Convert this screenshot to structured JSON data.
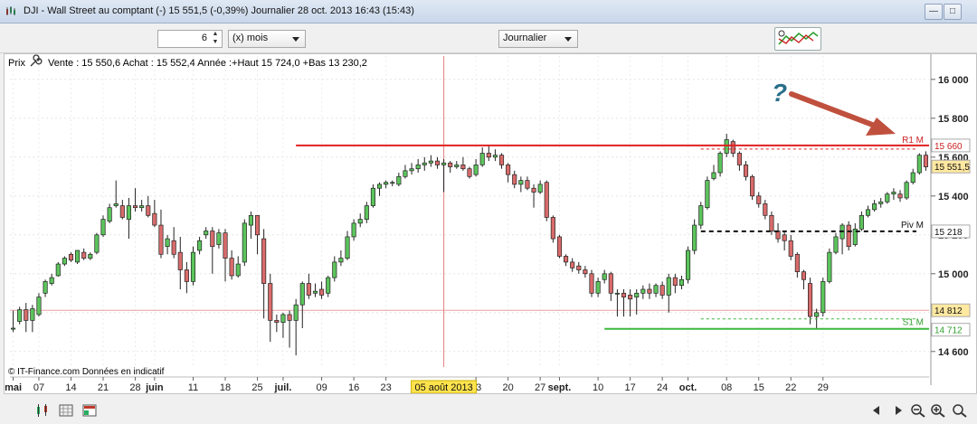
{
  "window": {
    "title": "DJI - Wall Street au comptant (-)   15 551,5 (-0,39%)   Journalier  28 oct. 2013 16:43 (15:43)"
  },
  "toolbar": {
    "period_value": "6",
    "period_unit": "(x) mois",
    "timeframe": "Journalier"
  },
  "chart_header": {
    "price_label": "Prix",
    "quote_text": "Vente : 15 550,6 Achat : 15 552,4 Année :+Haut 15 724,0 +Bas 13 230,2"
  },
  "annotation": {
    "question_mark": "?"
  },
  "levels": [
    {
      "name": "R1 M",
      "value": 15660,
      "value_label": "15 660",
      "color": "#cc1f1f"
    },
    {
      "name": "Piv M",
      "value": 15218,
      "value_label": "15 218",
      "color": "#111111"
    },
    {
      "name": "S1 M",
      "value": 14712,
      "value_label": "14 712",
      "color": "#2e9e2e"
    }
  ],
  "price_badges": {
    "current": "15 551,5",
    "hline": "14 812"
  },
  "footer": {
    "copyright": "© IT-Finance.com  Données en indicatif",
    "cursor_date": "05 août 2013"
  },
  "chart_data": {
    "type": "candlestick",
    "title": "DJI - Wall Street au comptant (-)",
    "ylim": [
      14520,
      16120
    ],
    "y_ticks": [
      14600,
      14800,
      15000,
      15200,
      15400,
      15600,
      15800,
      16000
    ],
    "y_tick_labels": [
      "14 600",
      "14 800",
      "15 000",
      "15 200",
      "15 400",
      "15 600",
      "15 800",
      "16 000"
    ],
    "x_labels": [
      {
        "i": 0,
        "text": "mai",
        "bold": true
      },
      {
        "i": 4,
        "text": "07",
        "bold": false
      },
      {
        "i": 9,
        "text": "14",
        "bold": false
      },
      {
        "i": 14,
        "text": "21",
        "bold": false
      },
      {
        "i": 19,
        "text": "28",
        "bold": false
      },
      {
        "i": 22,
        "text": "juin",
        "bold": true
      },
      {
        "i": 28,
        "text": "11",
        "bold": false
      },
      {
        "i": 33,
        "text": "18",
        "bold": false
      },
      {
        "i": 38,
        "text": "25",
        "bold": false
      },
      {
        "i": 42,
        "text": "juil.",
        "bold": true
      },
      {
        "i": 48,
        "text": "09",
        "bold": false
      },
      {
        "i": 53,
        "text": "16",
        "bold": false
      },
      {
        "i": 58,
        "text": "23",
        "bold": false
      },
      {
        "i": 72,
        "text": "13",
        "bold": false
      },
      {
        "i": 77,
        "text": "20",
        "bold": false
      },
      {
        "i": 82,
        "text": "27",
        "bold": false
      },
      {
        "i": 85,
        "text": "sept.",
        "bold": true
      },
      {
        "i": 91,
        "text": "10",
        "bold": false
      },
      {
        "i": 96,
        "text": "17",
        "bold": false
      },
      {
        "i": 101,
        "text": "24",
        "bold": false
      },
      {
        "i": 105,
        "text": "oct.",
        "bold": true
      },
      {
        "i": 111,
        "text": "08",
        "bold": false
      },
      {
        "i": 116,
        "text": "15",
        "bold": false
      },
      {
        "i": 121,
        "text": "22",
        "bold": false
      },
      {
        "i": 126,
        "text": "29",
        "bold": false
      }
    ],
    "cursor_index": 67,
    "red_line_value": 14812,
    "candles": [
      [
        14715,
        14720,
        14810,
        14700
      ],
      [
        14755,
        14815,
        14830,
        14740
      ],
      [
        14815,
        14760,
        14850,
        14700
      ],
      [
        14760,
        14820,
        14840,
        14700
      ],
      [
        14790,
        14880,
        14900,
        14780
      ],
      [
        14900,
        14960,
        14970,
        14880
      ],
      [
        14950,
        14980,
        15000,
        14940
      ],
      [
        14990,
        15050,
        15060,
        14985
      ],
      [
        15050,
        15080,
        15090,
        15040
      ],
      [
        15100,
        15070,
        15110,
        15060
      ],
      [
        15060,
        15120,
        15120,
        15050
      ],
      [
        15110,
        15080,
        15130,
        15070
      ],
      [
        15080,
        15100,
        15110,
        15070
      ],
      [
        15110,
        15200,
        15210,
        15100
      ],
      [
        15200,
        15280,
        15300,
        15190
      ],
      [
        15270,
        15340,
        15360,
        15260
      ],
      [
        15350,
        15360,
        15480,
        15340
      ],
      [
        15350,
        15290,
        15380,
        15280
      ],
      [
        15280,
        15350,
        15390,
        15180
      ],
      [
        15350,
        15340,
        15440,
        15320
      ],
      [
        15340,
        15350,
        15380,
        15320
      ],
      [
        15350,
        15300,
        15400,
        15290
      ],
      [
        15310,
        15250,
        15380,
        15240
      ],
      [
        15250,
        15100,
        15330,
        15080
      ],
      [
        15140,
        15180,
        15200,
        15100
      ],
      [
        15170,
        15100,
        15240,
        15080
      ],
      [
        15110,
        15020,
        15190,
        14920
      ],
      [
        15020,
        14960,
        15060,
        14900
      ],
      [
        14960,
        15110,
        15140,
        14940
      ],
      [
        15120,
        15170,
        15190,
        15100
      ],
      [
        15200,
        15220,
        15240,
        15180
      ],
      [
        15220,
        15140,
        15240,
        15000
      ],
      [
        15150,
        15210,
        15230,
        15130
      ],
      [
        15210,
        15080,
        15230,
        14960
      ],
      [
        15080,
        14990,
        15120,
        14970
      ],
      [
        14990,
        15050,
        15090,
        14980
      ],
      [
        15060,
        15260,
        15280,
        15040
      ],
      [
        15250,
        15300,
        15320,
        15180
      ],
      [
        15300,
        15200,
        15300,
        15100
      ],
      [
        15180,
        14950,
        15230,
        14770
      ],
      [
        14950,
        14760,
        15000,
        14650
      ],
      [
        14760,
        14750,
        14790,
        14700
      ],
      [
        14750,
        14790,
        14800,
        14670
      ],
      [
        14790,
        14760,
        14810,
        14620
      ],
      [
        14760,
        14840,
        14870,
        14580
      ],
      [
        14840,
        14950,
        14960,
        14720
      ],
      [
        14950,
        14890,
        15000,
        14870
      ],
      [
        14900,
        14910,
        14950,
        14880
      ],
      [
        14920,
        14890,
        14960,
        14870
      ],
      [
        14900,
        14980,
        14990,
        14880
      ],
      [
        14980,
        15060,
        15090,
        14960
      ],
      [
        15060,
        15080,
        15120,
        15040
      ],
      [
        15080,
        15190,
        15220,
        15070
      ],
      [
        15190,
        15260,
        15280,
        15170
      ],
      [
        15260,
        15280,
        15310,
        15240
      ],
      [
        15280,
        15350,
        15370,
        15260
      ],
      [
        15350,
        15440,
        15460,
        15340
      ],
      [
        15440,
        15460,
        15470,
        15400
      ],
      [
        15460,
        15470,
        15480,
        15440
      ],
      [
        15470,
        15470,
        15480,
        15450
      ],
      [
        15460,
        15500,
        15520,
        15450
      ],
      [
        15500,
        15530,
        15560,
        15490
      ],
      [
        15530,
        15540,
        15570,
        15510
      ],
      [
        15540,
        15560,
        15590,
        15520
      ],
      [
        15560,
        15570,
        15600,
        15530
      ],
      [
        15570,
        15580,
        15610,
        15550
      ],
      [
        15580,
        15560,
        15600,
        15540
      ],
      [
        15560,
        15570,
        15590,
        15420
      ],
      [
        15570,
        15550,
        15580,
        15520
      ],
      [
        15550,
        15560,
        15580,
        15540
      ],
      [
        15560,
        15540,
        15600,
        15530
      ],
      [
        15540,
        15500,
        15550,
        15490
      ],
      [
        15510,
        15560,
        15590,
        15500
      ],
      [
        15560,
        15620,
        15650,
        15550
      ],
      [
        15620,
        15600,
        15660,
        15580
      ],
      [
        15600,
        15610,
        15640,
        15580
      ],
      [
        15610,
        15560,
        15620,
        15540
      ],
      [
        15560,
        15510,
        15570,
        15470
      ],
      [
        15510,
        15460,
        15530,
        15440
      ],
      [
        15460,
        15480,
        15500,
        15420
      ],
      [
        15480,
        15440,
        15500,
        15430
      ],
      [
        15440,
        15420,
        15460,
        15340
      ],
      [
        15420,
        15460,
        15480,
        15410
      ],
      [
        15470,
        15290,
        15480,
        15270
      ],
      [
        15290,
        15180,
        15300,
        15160
      ],
      [
        15190,
        15090,
        15200,
        15080
      ],
      [
        15090,
        15060,
        15100,
        15040
      ],
      [
        15060,
        15030,
        15080,
        15010
      ],
      [
        15040,
        15020,
        15060,
        15000
      ],
      [
        15020,
        15000,
        15040,
        14980
      ],
      [
        15000,
        14900,
        15020,
        14880
      ],
      [
        14900,
        14960,
        14980,
        14880
      ],
      [
        14970,
        15000,
        15020,
        14950
      ],
      [
        15000,
        14900,
        15010,
        14860
      ],
      [
        14900,
        14900,
        14920,
        14780
      ],
      [
        14900,
        14880,
        14920,
        14780
      ],
      [
        14890,
        14870,
        14920,
        14780
      ],
      [
        14880,
        14900,
        14920,
        14790
      ],
      [
        14900,
        14920,
        14940,
        14870
      ],
      [
        14920,
        14900,
        14950,
        14870
      ],
      [
        14900,
        14940,
        14950,
        14880
      ],
      [
        14940,
        14890,
        14960,
        14870
      ],
      [
        14890,
        14980,
        15000,
        14800
      ],
      [
        14980,
        14940,
        15000,
        14900
      ],
      [
        14940,
        14970,
        14990,
        14920
      ],
      [
        14970,
        15120,
        15140,
        14950
      ],
      [
        15120,
        15250,
        15280,
        15100
      ],
      [
        15250,
        15350,
        15370,
        15230
      ],
      [
        15340,
        15480,
        15500,
        15330
      ],
      [
        15490,
        15520,
        15560,
        15480
      ],
      [
        15520,
        15620,
        15630,
        15500
      ],
      [
        15620,
        15690,
        15720,
        15600
      ],
      [
        15680,
        15620,
        15690,
        15600
      ],
      [
        15620,
        15560,
        15630,
        15530
      ],
      [
        15560,
        15500,
        15580,
        15480
      ],
      [
        15500,
        15400,
        15510,
        15380
      ],
      [
        15400,
        15360,
        15420,
        15340
      ],
      [
        15360,
        15300,
        15380,
        15280
      ],
      [
        15300,
        15220,
        15320,
        15200
      ],
      [
        15220,
        15180,
        15260,
        15160
      ],
      [
        15200,
        15170,
        15220,
        15120
      ]
    ],
    "candles_tail": [
      [
        15170,
        15090,
        15200,
        15070
      ],
      [
        15100,
        15010,
        15110,
        14980
      ],
      [
        15010,
        14970,
        15020,
        14920
      ],
      [
        14950,
        14780,
        14980,
        14740
      ],
      [
        14780,
        14800,
        14820,
        14720
      ],
      [
        14800,
        14960,
        14980,
        14780
      ],
      [
        14960,
        15110,
        15130,
        14950
      ],
      [
        15110,
        15190,
        15210,
        15100
      ],
      [
        15180,
        15250,
        15260,
        15100
      ],
      [
        15250,
        15140,
        15270,
        15120
      ],
      [
        15150,
        15230,
        15260,
        15140
      ],
      [
        15230,
        15300,
        15320,
        15220
      ],
      [
        15300,
        15330,
        15350,
        15290
      ],
      [
        15330,
        15360,
        15380,
        15320
      ],
      [
        15360,
        15370,
        15390,
        15340
      ],
      [
        15370,
        15410,
        15420,
        15360
      ],
      [
        15410,
        15420,
        15440,
        15380
      ],
      [
        15410,
        15390,
        15430,
        15370
      ],
      [
        15390,
        15470,
        15480,
        15380
      ],
      [
        15470,
        15520,
        15540,
        15460
      ],
      [
        15520,
        15610,
        15620,
        15510
      ],
      [
        15610,
        15550,
        15630,
        15530
      ]
    ]
  }
}
